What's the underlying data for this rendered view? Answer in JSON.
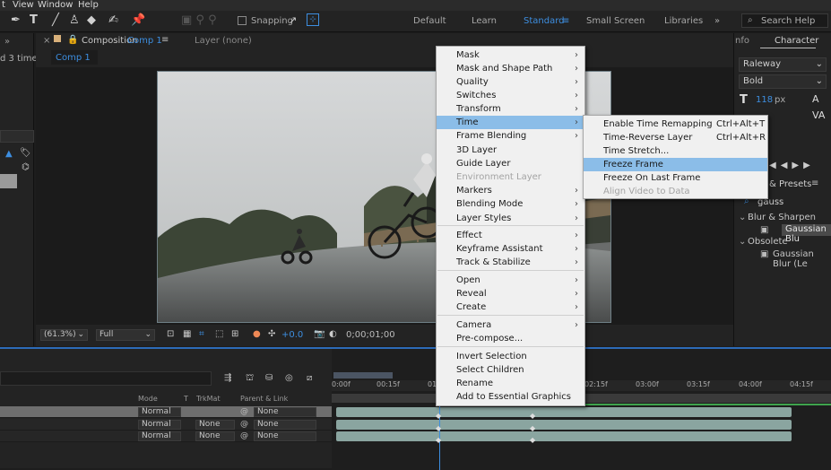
{
  "menubar": {
    "items": [
      "t",
      "View",
      "Window",
      "Help"
    ]
  },
  "toolbar": {
    "snapping_label": "Snapping"
  },
  "workspaces": [
    "Default",
    "Learn",
    "Standard",
    "Small Screen",
    "Libraries"
  ],
  "search_help": {
    "placeholder": "Search Help"
  },
  "left_panel": {
    "text": "d 3 times"
  },
  "comp_panel": {
    "tab_prefix": "Composition",
    "tab_comp": "Comp 1",
    "layer_label": "Layer (none)",
    "comp_tab": "Comp 1",
    "zoom": "(61.3%)",
    "resolution": "Full",
    "exposure": "+0.0",
    "timecode": "0;00;01;00"
  },
  "right_panel": {
    "info_tab": "nfo",
    "character_tab": "Character",
    "font": "Raleway",
    "weight": "Bold",
    "size": "118",
    "size_unit": "px",
    "presets_tab": "& Presets",
    "search_value": "gauss",
    "group_blur": "Blur & Sharpen",
    "item_gaussian": "Gaussian Blu",
    "group_obsolete": "Obsolete",
    "item_gaussian_legacy": "Gaussian Blur (Le"
  },
  "timeline": {
    "col_mode": "Mode",
    "col_t": "T",
    "col_trkmat": "TrkMat",
    "col_parent": "Parent & Link",
    "ruler": [
      "0:00f",
      "00:15f",
      "01",
      "02:15f",
      "03:00f",
      "03:15f",
      "04:00f",
      "04:15f"
    ],
    "rows": [
      {
        "mode": "Normal",
        "trkmat": "",
        "parent": "None"
      },
      {
        "mode": "Normal",
        "trkmat": "None",
        "parent": "None"
      },
      {
        "mode": "Normal",
        "trkmat": "None",
        "parent": "None"
      }
    ]
  },
  "context_menu": {
    "items": [
      {
        "label": "Mask",
        "submenu": true
      },
      {
        "label": "Mask and Shape Path",
        "submenu": true
      },
      {
        "label": "Quality",
        "submenu": true
      },
      {
        "label": "Switches",
        "submenu": true
      },
      {
        "label": "Transform",
        "submenu": true
      },
      {
        "label": "Time",
        "submenu": true,
        "highlighted": true
      },
      {
        "label": "Frame Blending",
        "submenu": true
      },
      {
        "label": "3D Layer"
      },
      {
        "label": "Guide Layer"
      },
      {
        "label": "Environment Layer",
        "disabled": true
      },
      {
        "label": "Markers",
        "submenu": true
      },
      {
        "label": "Blending Mode",
        "submenu": true
      },
      {
        "label": "Layer Styles",
        "submenu": true
      },
      {
        "label": "Effect",
        "submenu": true
      },
      {
        "label": "Keyframe Assistant",
        "submenu": true
      },
      {
        "label": "Track & Stabilize",
        "submenu": true
      },
      {
        "label": "Open",
        "submenu": true
      },
      {
        "label": "Reveal",
        "submenu": true
      },
      {
        "label": "Create",
        "submenu": true
      },
      {
        "label": "Camera",
        "submenu": true
      },
      {
        "label": "Pre-compose..."
      },
      {
        "label": "Invert Selection"
      },
      {
        "label": "Select Children"
      },
      {
        "label": "Rename"
      },
      {
        "label": "Add to Essential Graphics"
      }
    ]
  },
  "time_submenu": {
    "items": [
      {
        "label": "Enable Time Remapping",
        "shortcut": "Ctrl+Alt+T"
      },
      {
        "label": "Time-Reverse Layer",
        "shortcut": "Ctrl+Alt+R"
      },
      {
        "label": "Time Stretch..."
      },
      {
        "label": "Freeze Frame",
        "highlighted": true
      },
      {
        "label": "Freeze On Last Frame"
      },
      {
        "label": "Align Video to Data",
        "disabled": true
      }
    ]
  },
  "colors": {
    "accent": "#3d8ee0",
    "menu_bg": "#f0f0f0",
    "menu_highlight": "#8bbde8"
  },
  "icons": [
    "pen-icon",
    "type-icon",
    "brush-icon",
    "stamp-icon",
    "eraser-icon",
    "roto-brush-icon",
    "puppet-pin-icon",
    "workspace-menu-icon",
    "search-icon"
  ]
}
